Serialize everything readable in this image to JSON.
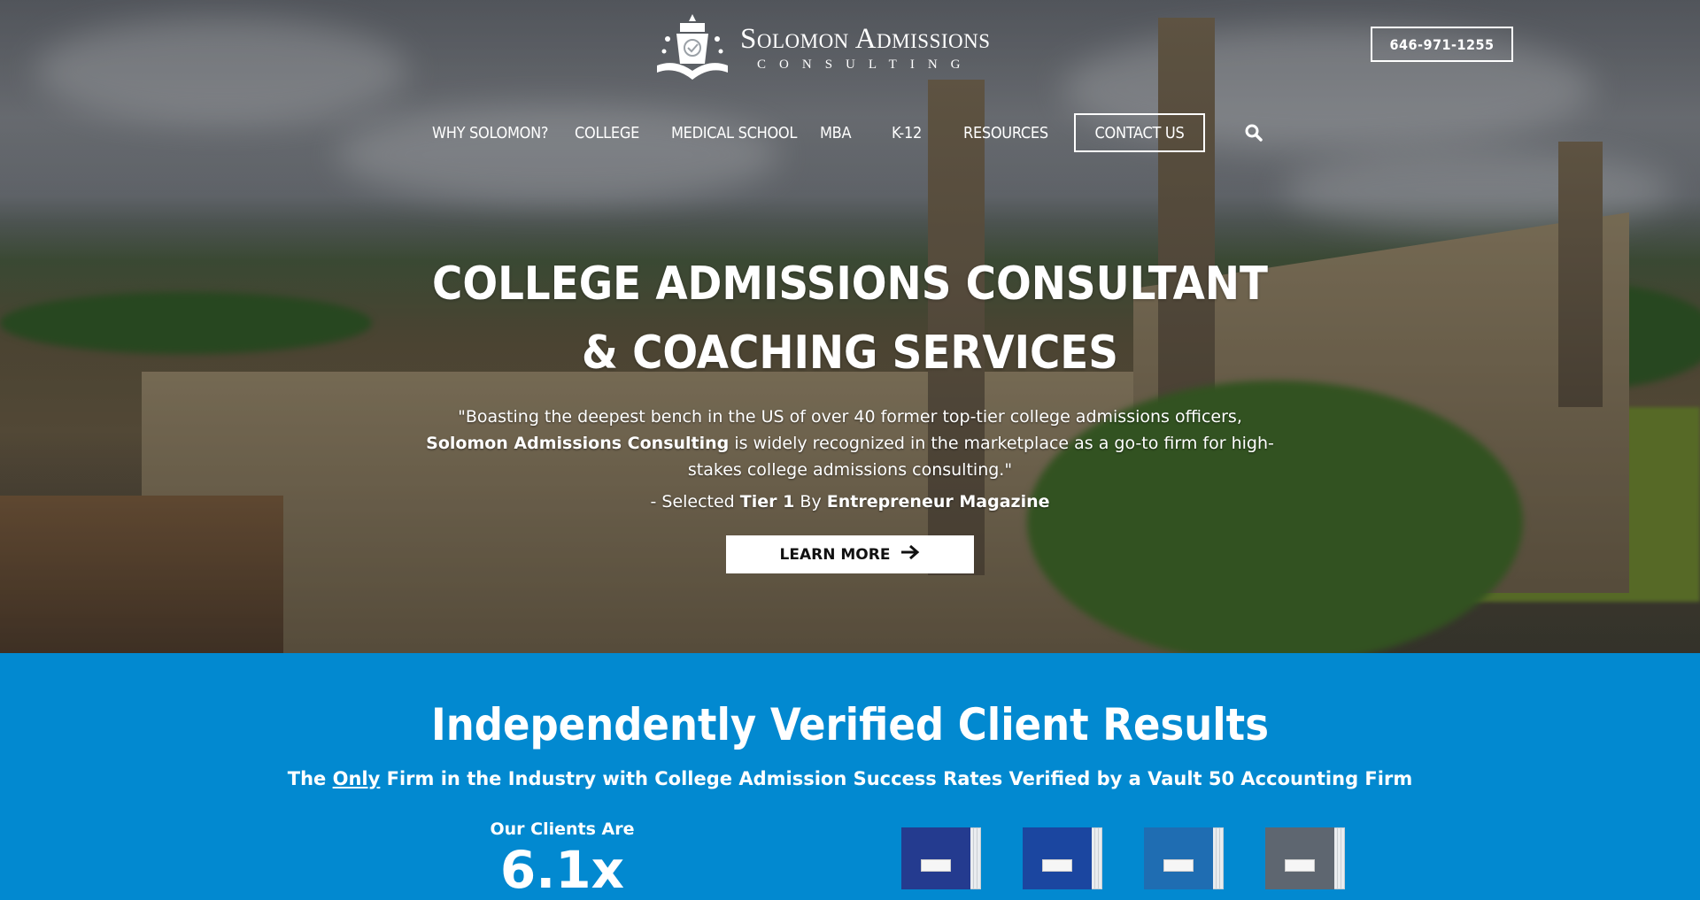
{
  "header": {
    "logo": {
      "title": "Solomon Admissions",
      "subtitle": "CONSULTING"
    },
    "phone": "646-971-1255"
  },
  "nav": {
    "items": [
      {
        "label": "WHY SOLOMON?"
      },
      {
        "label": "COLLEGE"
      },
      {
        "label": "MEDICAL SCHOOL"
      },
      {
        "label": "MBA"
      },
      {
        "label": "K-12"
      },
      {
        "label": "RESOURCES"
      },
      {
        "label": "CONTACT US"
      }
    ],
    "search_icon": "search-icon"
  },
  "hero": {
    "title_line1": "COLLEGE ADMISSIONS CONSULTANT",
    "title_line2": "& COACHING SERVICES",
    "quote_part1": "\"Boasting the deepest bench in the US of over 40 former top-tier college admissions officers,",
    "quote_bold": "Solomon Admissions Consulting",
    "quote_part2": " is widely recognized in the marketplace as a go-to firm for high-stakes college admissions consulting.\"",
    "attribution_prefix": "- Selected ",
    "attribution_tier": "Tier 1",
    "attribution_by": " By ",
    "attribution_source": "Entrepreneur Magazine",
    "cta_label": "LEARN MORE",
    "cta_icon": "arrow-right-icon"
  },
  "results": {
    "title": "Independently Verified Client Results",
    "subtitle_prefix": "The ",
    "subtitle_emphasis": "Only",
    "subtitle_suffix": " Firm in the Industry with College Admission Success Rates Verified by a Vault 50 Accounting Firm",
    "clients_label": "Our Clients Are",
    "clients_stat": "6.1x",
    "report_colors": [
      "#243b8f",
      "#1b46a0",
      "#1f6db2",
      "#5e6670"
    ]
  },
  "colors": {
    "accent_blue": "#0289d0",
    "white": "#ffffff"
  }
}
